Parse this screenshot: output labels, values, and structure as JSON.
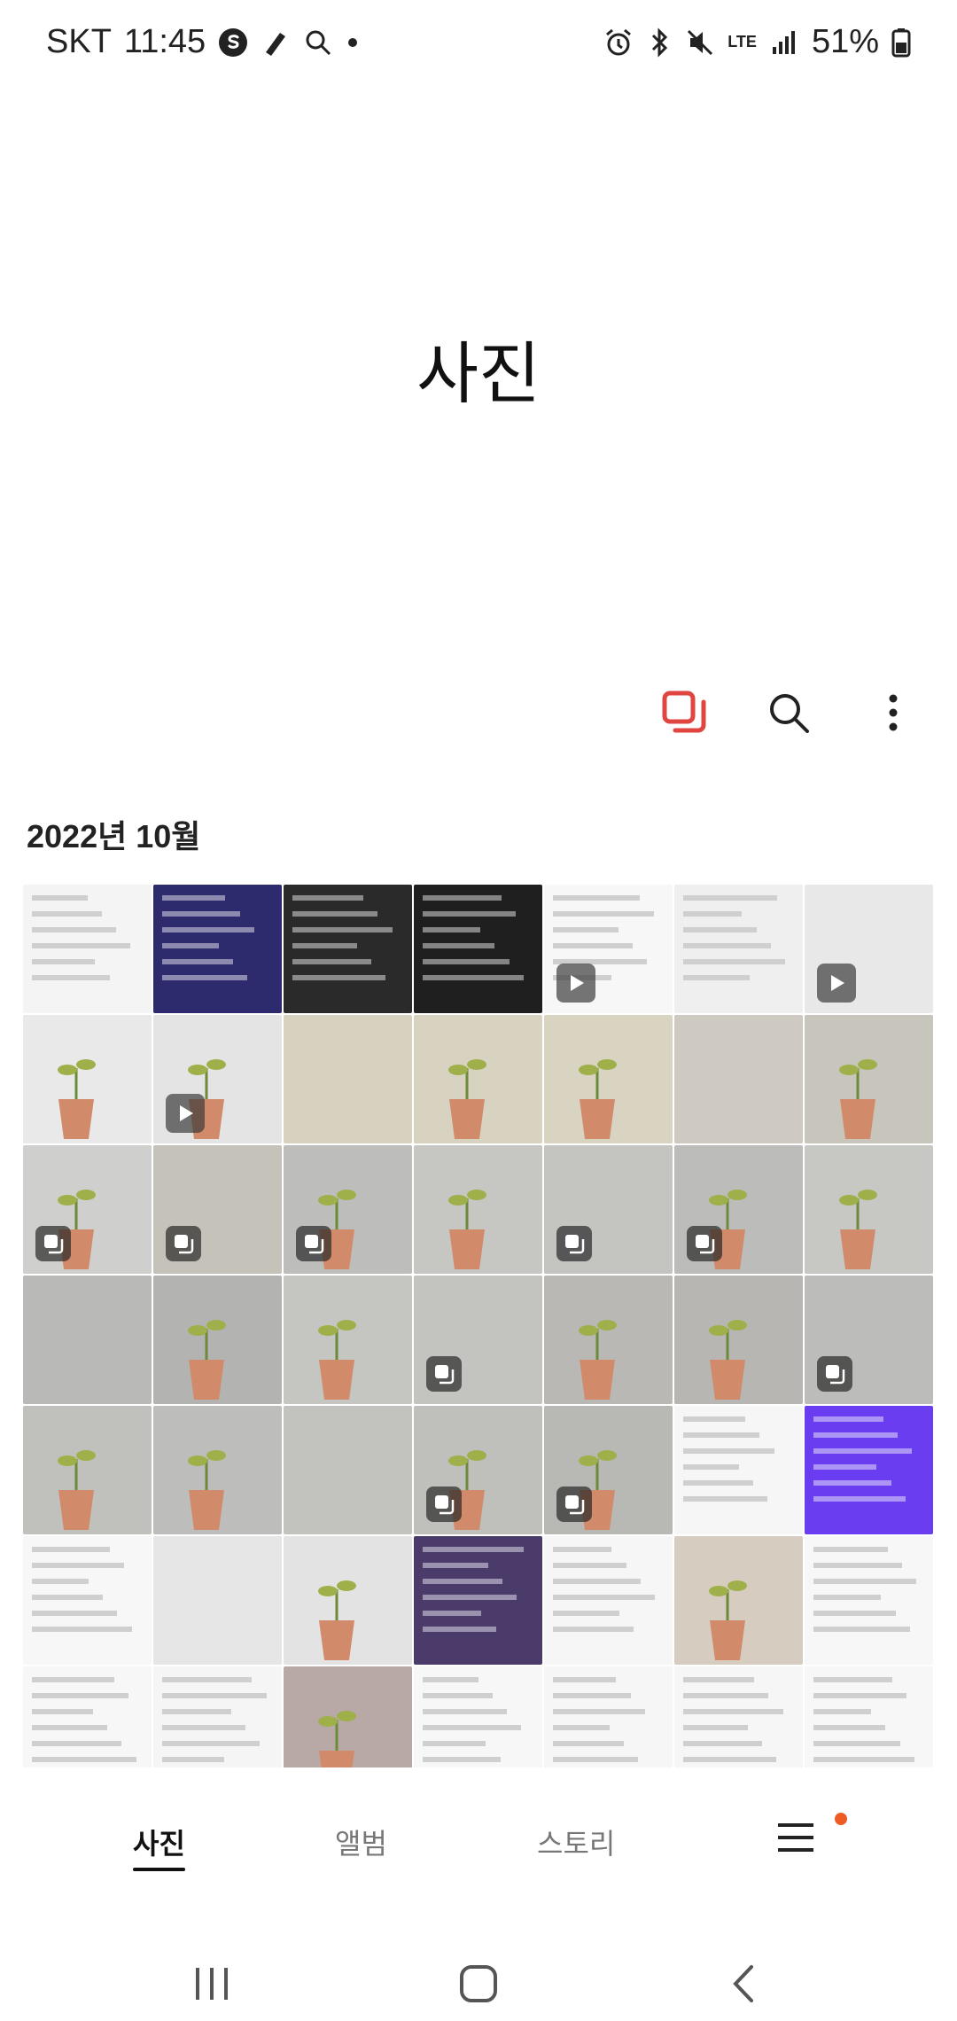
{
  "status_bar": {
    "carrier": "SKT",
    "time": "11:45",
    "network": "LTE",
    "battery": "51%"
  },
  "header": {
    "title": "사진"
  },
  "section": {
    "date": "2022년 10월"
  },
  "thumbnails": [
    {
      "kind": "screenshot",
      "badge": "none",
      "bg": "#f4f4f4"
    },
    {
      "kind": "screenshot",
      "badge": "none",
      "bg": "#2e2a6e"
    },
    {
      "kind": "screenshot",
      "badge": "none",
      "bg": "#2a2a2a"
    },
    {
      "kind": "screenshot",
      "badge": "none",
      "bg": "#1f1f1f"
    },
    {
      "kind": "screenshot",
      "badge": "video",
      "bg": "#f7f7f7"
    },
    {
      "kind": "screenshot",
      "badge": "none",
      "bg": "#efefef"
    },
    {
      "kind": "photo",
      "badge": "video",
      "bg": "#e8e8e8"
    },
    {
      "kind": "photo",
      "badge": "none",
      "bg": "#e9e9e9"
    },
    {
      "kind": "photo",
      "badge": "video",
      "bg": "#e4e4e4"
    },
    {
      "kind": "photo",
      "badge": "none",
      "bg": "#d7d2bf"
    },
    {
      "kind": "photo",
      "badge": "none",
      "bg": "#d8d3c0"
    },
    {
      "kind": "photo",
      "badge": "none",
      "bg": "#d9d4c1"
    },
    {
      "kind": "photo",
      "badge": "none",
      "bg": "#cfcac1"
    },
    {
      "kind": "photo",
      "badge": "none",
      "bg": "#c8c5bd"
    },
    {
      "kind": "photo",
      "badge": "burst",
      "bg": "#cfcfcd"
    },
    {
      "kind": "photo",
      "badge": "burst",
      "bg": "#c5c2b9"
    },
    {
      "kind": "photo",
      "badge": "burst",
      "bg": "#bdbdbb"
    },
    {
      "kind": "photo",
      "badge": "none",
      "bg": "#c6c6c3"
    },
    {
      "kind": "photo",
      "badge": "burst",
      "bg": "#c4c4c1"
    },
    {
      "kind": "photo",
      "badge": "burst",
      "bg": "#bcbcba"
    },
    {
      "kind": "photo",
      "badge": "none",
      "bg": "#c7c7c4"
    },
    {
      "kind": "photo",
      "badge": "none",
      "bg": "#b9b9b7"
    },
    {
      "kind": "photo",
      "badge": "none",
      "bg": "#b3b3b1"
    },
    {
      "kind": "photo",
      "badge": "none",
      "bg": "#c5c5c2"
    },
    {
      "kind": "photo",
      "badge": "burst",
      "bg": "#c3c3c0"
    },
    {
      "kind": "photo",
      "badge": "none",
      "bg": "#b9b8b5"
    },
    {
      "kind": "photo",
      "badge": "none",
      "bg": "#b7b6b3"
    },
    {
      "kind": "photo",
      "badge": "burst",
      "bg": "#bcbcba"
    },
    {
      "kind": "photo",
      "badge": "none",
      "bg": "#c0c0bd"
    },
    {
      "kind": "photo",
      "badge": "none",
      "bg": "#bdbdbb"
    },
    {
      "kind": "photo",
      "badge": "none",
      "bg": "#c2c2bf"
    },
    {
      "kind": "photo",
      "badge": "burst",
      "bg": "#bfbfbc"
    },
    {
      "kind": "photo",
      "badge": "burst",
      "bg": "#b8b8b5"
    },
    {
      "kind": "screenshot",
      "badge": "none",
      "bg": "#f6f6f6"
    },
    {
      "kind": "screenshot",
      "badge": "none",
      "bg": "#6a3df0"
    },
    {
      "kind": "screenshot",
      "badge": "none",
      "bg": "#f7f7f7"
    },
    {
      "kind": "photo",
      "badge": "none",
      "bg": "#e6e6e6"
    },
    {
      "kind": "photo",
      "badge": "none",
      "bg": "#e3e3e3"
    },
    {
      "kind": "screenshot",
      "badge": "none",
      "bg": "#4a3b6b"
    },
    {
      "kind": "screenshot",
      "badge": "none",
      "bg": "#f6f6f6"
    },
    {
      "kind": "photo",
      "badge": "none",
      "bg": "#d6ccc0"
    },
    {
      "kind": "screenshot",
      "badge": "none",
      "bg": "#f7f7f7"
    },
    {
      "kind": "screenshot",
      "badge": "none",
      "bg": "#f7f7f7"
    },
    {
      "kind": "screenshot",
      "badge": "none",
      "bg": "#f5f5f5"
    },
    {
      "kind": "photo",
      "badge": "none",
      "bg": "#b8a9a6"
    },
    {
      "kind": "screenshot",
      "badge": "none",
      "bg": "#f7f7f7"
    },
    {
      "kind": "screenshot",
      "badge": "none",
      "bg": "#f6f6f6"
    },
    {
      "kind": "screenshot",
      "badge": "none",
      "bg": "#f6f6f6"
    },
    {
      "kind": "screenshot",
      "badge": "none",
      "bg": "#f7f7f7"
    }
  ],
  "bottom_nav": {
    "tabs": [
      {
        "label": "사진",
        "active": true
      },
      {
        "label": "앨범",
        "active": false
      },
      {
        "label": "스토리",
        "active": false
      }
    ]
  }
}
